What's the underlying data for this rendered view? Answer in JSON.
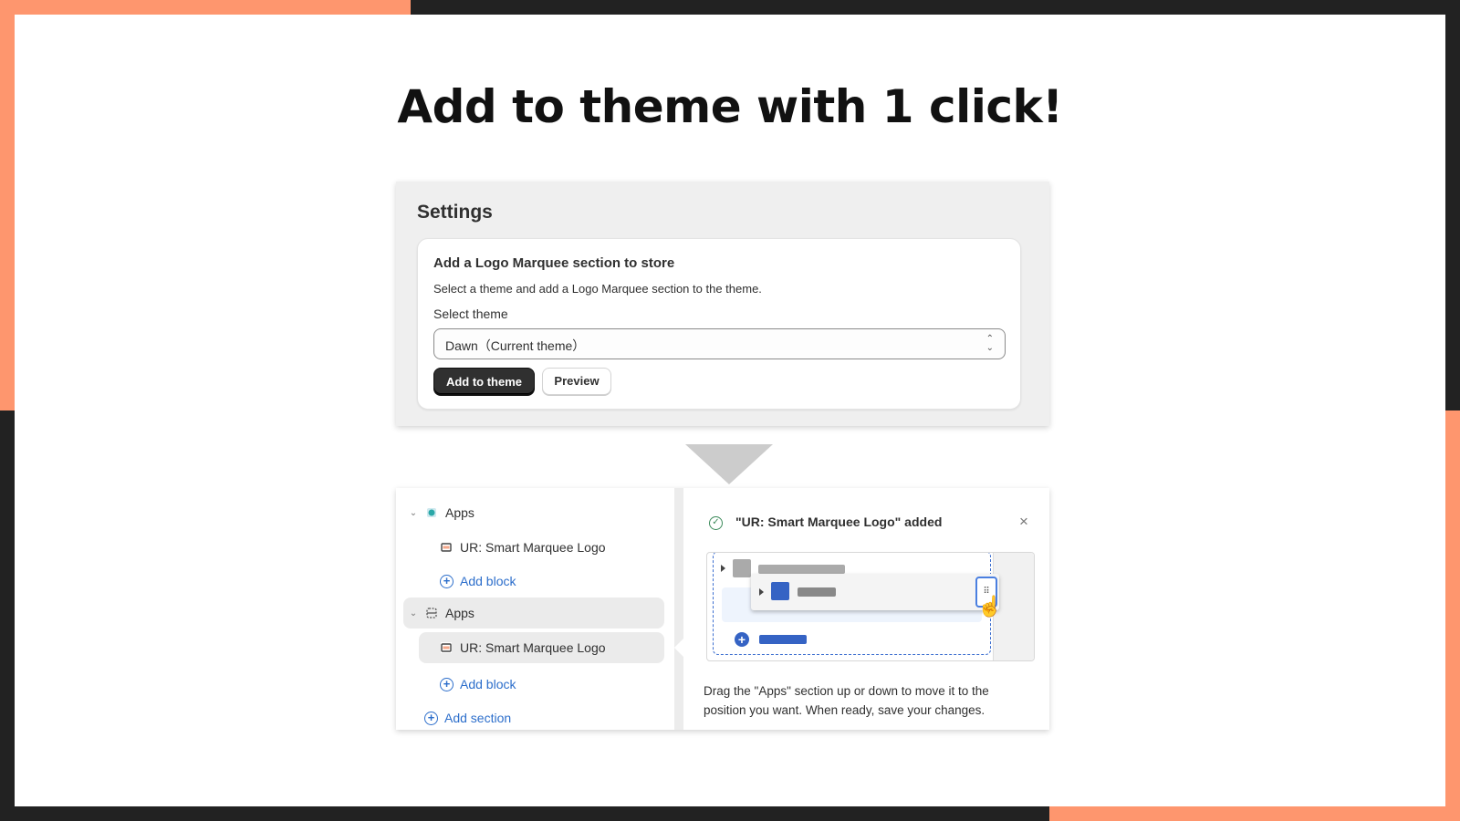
{
  "colors": {
    "accent_orange": "#fe966e",
    "frame_dark": "#222222",
    "link_blue": "#2c6ecb",
    "success_green": "#3b8a5a"
  },
  "headline": "Add to theme with 1 click!",
  "settings": {
    "title": "Settings",
    "card": {
      "title": "Add a Logo Marquee section to store",
      "description": "Select a theme and add a Logo Marquee section to the theme.",
      "select_label": "Select theme",
      "select_value": "Dawn（Current theme）",
      "primary_button": "Add to theme",
      "secondary_button": "Preview"
    }
  },
  "arrow_icon": "triangle-down-icon",
  "editor": {
    "tree": [
      {
        "type": "section",
        "label": "Apps",
        "icon": "app-icon"
      },
      {
        "type": "block",
        "label": "UR: Smart Marquee Logo",
        "icon": "block-icon"
      },
      {
        "type": "add",
        "label": "Add block"
      },
      {
        "type": "section",
        "label": "Apps",
        "icon": "section-icon",
        "selected": true
      },
      {
        "type": "block",
        "label": "UR: Smart Marquee Logo",
        "icon": "block-icon",
        "selected": true
      },
      {
        "type": "add",
        "label": "Add block"
      },
      {
        "type": "add-section",
        "label": "Add section"
      }
    ],
    "notice": {
      "title": "\"UR: Smart Marquee Logo\" added",
      "close_icon": "close-icon",
      "body": "Drag the \"Apps\" section up or down to move it to the position you want. When ready, save your changes."
    }
  }
}
